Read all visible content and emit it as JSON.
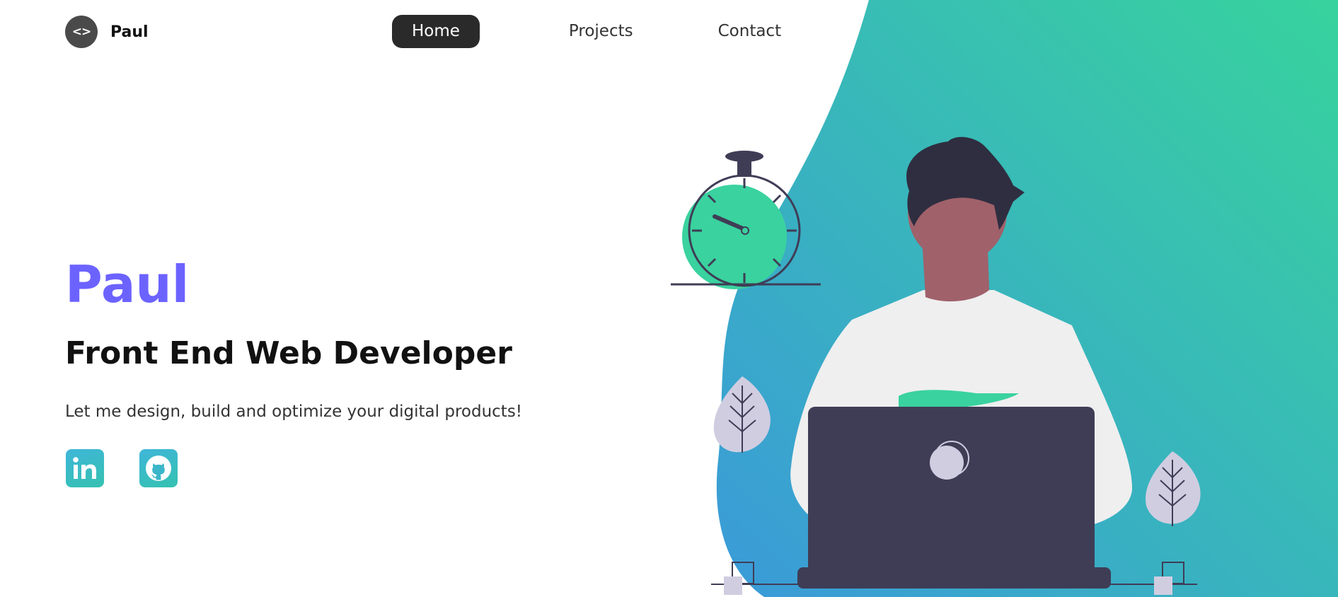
{
  "nav": {
    "brand_logo_text": "<>",
    "brand_name": "Paul",
    "links": [
      {
        "label": "Home",
        "active": true
      },
      {
        "label": "Projects",
        "active": false
      },
      {
        "label": "Contact",
        "active": false
      }
    ]
  },
  "hero": {
    "name": "Paul",
    "role": "Front End Web Developer",
    "tagline": "Let me design, build and optimize your digital products!"
  },
  "social": [
    {
      "icon": "linkedin-icon"
    },
    {
      "icon": "github-icon"
    }
  ],
  "colors": {
    "accent": "#6c63ff",
    "gradient_start": "#3aa3d8",
    "gradient_end": "#38d39f",
    "nav_active_bg": "#2a2a2a",
    "clock_green": "#3ad29f",
    "laptop": "#3f3d56"
  }
}
